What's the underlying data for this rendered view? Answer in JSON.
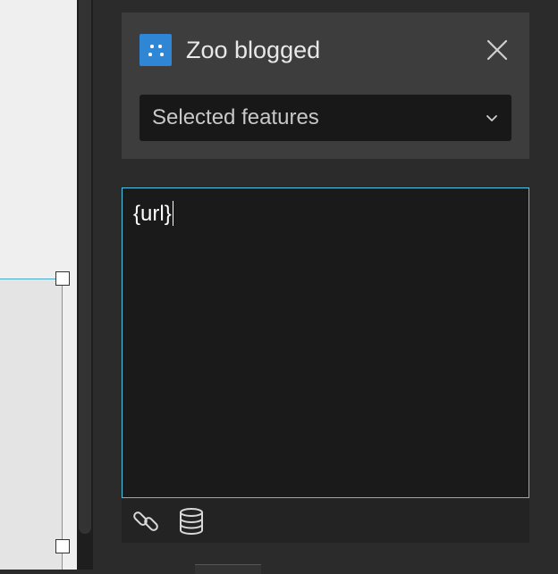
{
  "widget": {
    "title": "Zoo blogged",
    "icon": "widget-grid-icon",
    "accent_color": "#2e86d4"
  },
  "source_select": {
    "selected": "Selected features",
    "icon": "chevron-down-icon"
  },
  "editor": {
    "content": "{url}",
    "focus_border_color": "#4cc5e6"
  },
  "toolbar": {
    "buttons": [
      {
        "icon": "link-icon"
      },
      {
        "icon": "database-icon"
      }
    ]
  }
}
